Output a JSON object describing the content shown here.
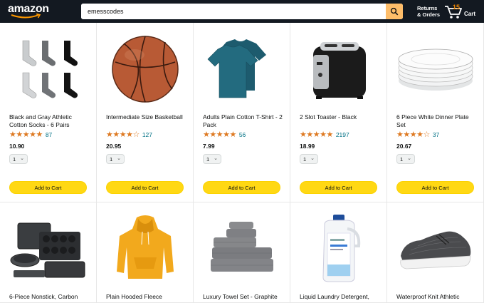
{
  "header": {
    "logo_text": "amazon",
    "search_value": "emesscodes",
    "returns_line1": "Returns",
    "returns_line2": "& Orders",
    "cart_count": "15",
    "cart_label": "Cart"
  },
  "products_row1": [
    {
      "name": "Black and Gray Athletic Cotton Socks - 6 Pairs",
      "stars": "★★★★★",
      "rating": 4.5,
      "reviews": "87",
      "price": "10.90",
      "qty": "1",
      "button": "Add to Cart",
      "icon": "socks-image"
    },
    {
      "name": "Intermediate Size Basketball",
      "stars": "★★★★☆",
      "rating": 4.0,
      "reviews": "127",
      "price": "20.95",
      "qty": "1",
      "button": "Add to Cart",
      "icon": "basketball-image"
    },
    {
      "name": "Adults Plain Cotton T-Shirt - 2 Pack",
      "stars": "★★★★★",
      "rating": 4.5,
      "reviews": "56",
      "price": "7.99",
      "qty": "1",
      "button": "Add to Cart",
      "icon": "tshirt-image"
    },
    {
      "name": "2 Slot Toaster - Black",
      "stars": "★★★★★",
      "rating": 5.0,
      "reviews": "2197",
      "price": "18.99",
      "qty": "1",
      "button": "Add to Cart",
      "icon": "toaster-image"
    },
    {
      "name": "6 Piece White Dinner Plate Set",
      "stars": "★★★★☆",
      "rating": 4.0,
      "reviews": "37",
      "price": "20.67",
      "qty": "1",
      "button": "Add to Cart",
      "icon": "plates-image"
    }
  ],
  "products_row2": [
    {
      "name": "6-Piece Nonstick, Carbon",
      "icon": "bakeware-image"
    },
    {
      "name": "Plain Hooded Fleece",
      "icon": "hoodie-image"
    },
    {
      "name": "Luxury Towel Set - Graphite",
      "icon": "towels-image"
    },
    {
      "name": "Liquid Laundry Detergent,",
      "icon": "detergent-image"
    },
    {
      "name": "Waterproof Knit Athletic",
      "icon": "shoe-image"
    }
  ],
  "colors": {
    "header_bg": "#131921",
    "search_button": "#febd69",
    "add_to_cart": "#ffd814",
    "stars": "#de7921",
    "link": "#007185",
    "cart_count": "#f08804"
  }
}
